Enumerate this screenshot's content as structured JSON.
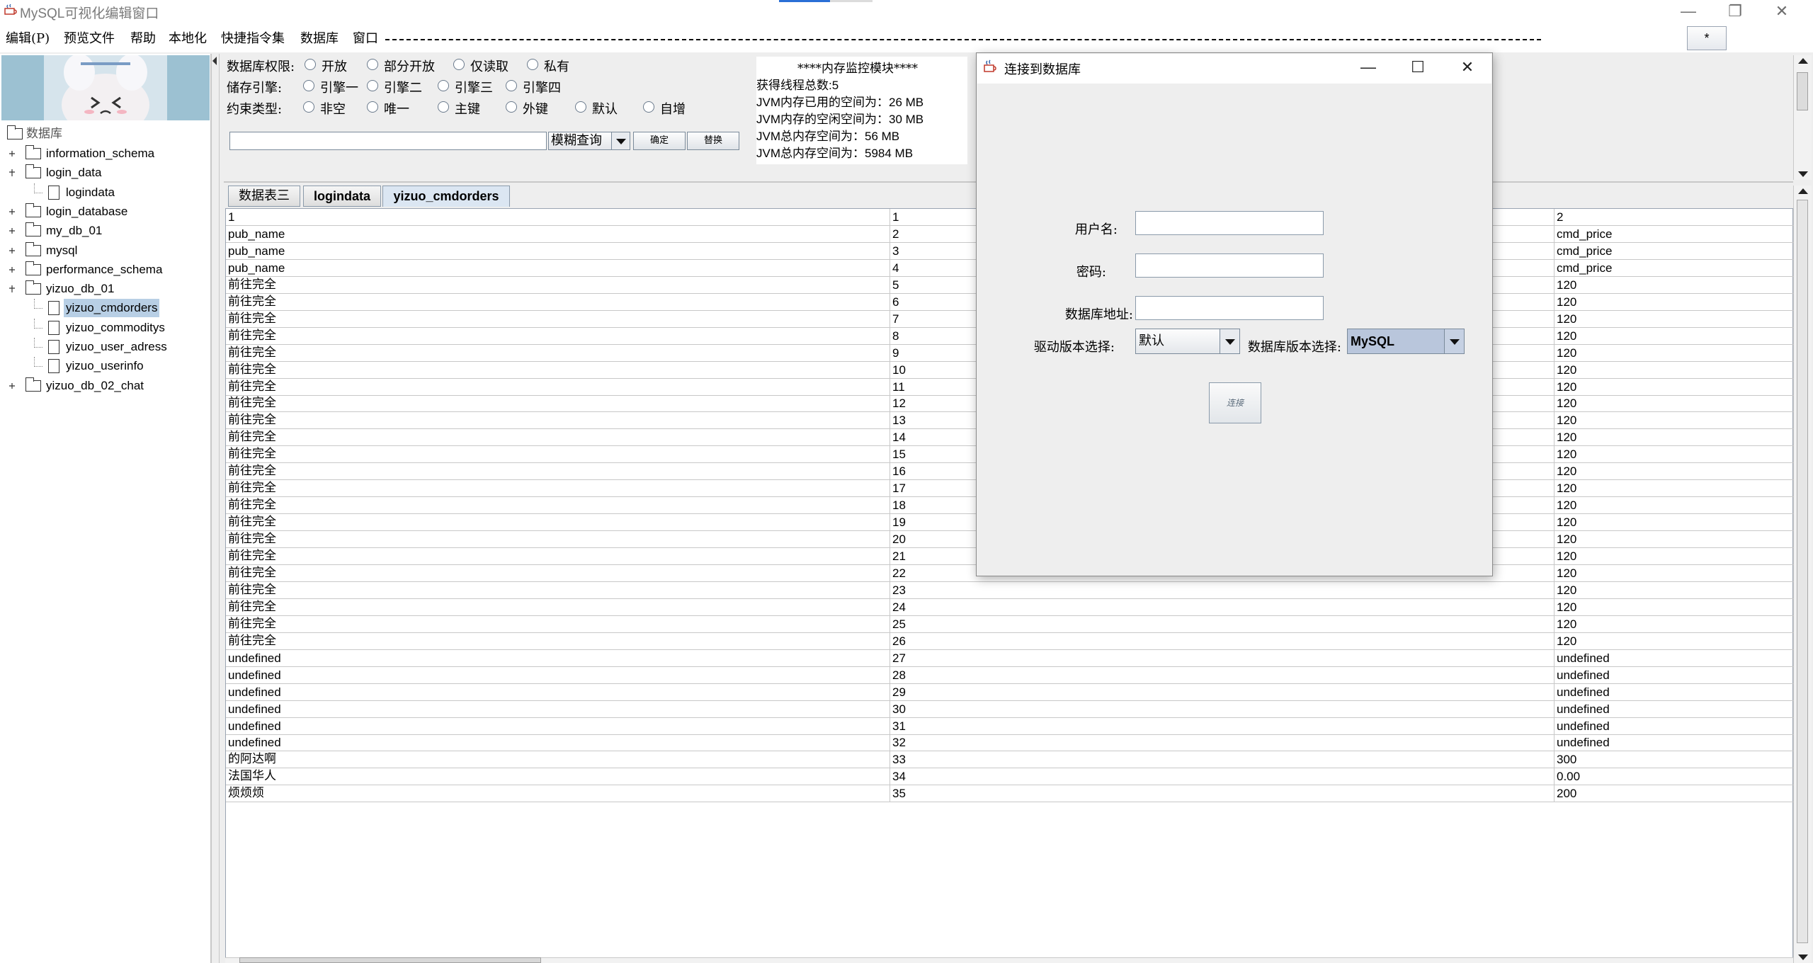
{
  "window": {
    "title": "MySQL可视化编辑窗口",
    "controls": {
      "minimize": "—",
      "restore": "❐",
      "close": "✕"
    }
  },
  "menu": {
    "items": [
      "编辑(P)",
      "预览文件",
      "帮助",
      "本地化",
      "快捷指令集",
      "数据库",
      "窗口"
    ],
    "star_button": "*"
  },
  "tree": {
    "root": "数据库",
    "nodes": [
      {
        "label": "information_schema",
        "type": "folder",
        "level": 1
      },
      {
        "label": "login_data",
        "type": "folder",
        "level": 1,
        "expanded": true
      },
      {
        "label": "logindata",
        "type": "file",
        "level": 2
      },
      {
        "label": "login_database",
        "type": "folder",
        "level": 1
      },
      {
        "label": "my_db_01",
        "type": "folder",
        "level": 1
      },
      {
        "label": "mysql",
        "type": "folder",
        "level": 1
      },
      {
        "label": "performance_schema",
        "type": "folder",
        "level": 1
      },
      {
        "label": "yizuo_db_01",
        "type": "folder",
        "level": 1,
        "expanded": true
      },
      {
        "label": "yizuo_cmdorders",
        "type": "file",
        "level": 2,
        "selected": true
      },
      {
        "label": "yizuo_commoditys",
        "type": "file",
        "level": 2
      },
      {
        "label": "yizuo_user_adress",
        "type": "file",
        "level": 2
      },
      {
        "label": "yizuo_userinfo",
        "type": "file",
        "level": 2
      },
      {
        "label": "yizuo_db_02_chat",
        "type": "folder",
        "level": 1
      }
    ]
  },
  "options": {
    "permission": {
      "label": "数据库权限:",
      "choices": [
        "开放",
        "部分开放",
        "仅读取",
        "私有"
      ]
    },
    "engine": {
      "label": "储存引擎:",
      "choices": [
        "引擎一",
        "引擎二",
        "引擎三",
        "引擎四"
      ]
    },
    "constraint": {
      "label": "约束类型:",
      "choices": [
        "非空",
        "唯一",
        "主键",
        "外键",
        "默认",
        "自增"
      ]
    },
    "search": {
      "value": "",
      "mode": "模糊查询",
      "confirm": "确定",
      "replace": "替换"
    }
  },
  "memory": {
    "header": "****内存监控模块****",
    "lines": [
      "获得线程总数:5",
      "JVM内存已用的空间为：26 MB",
      "JVM内存的空闲空间为：30 MB",
      "JVM总内存空间为：56 MB",
      "JVM总内存空间为：5984 MB"
    ]
  },
  "tabs": [
    "数据表三",
    "logindata",
    "yizuo_cmdorders"
  ],
  "active_tab": "yizuo_cmdorders",
  "table": {
    "rows": [
      [
        "1",
        "1",
        "2"
      ],
      [
        "pub_name",
        "2",
        "cmd_price"
      ],
      [
        "pub_name",
        "3",
        "cmd_price"
      ],
      [
        "pub_name",
        "4",
        "cmd_price"
      ],
      [
        "前往完全",
        "5",
        "120"
      ],
      [
        "前往完全",
        "6",
        "120"
      ],
      [
        "前往完全",
        "7",
        "120"
      ],
      [
        "前往完全",
        "8",
        "120"
      ],
      [
        "前往完全",
        "9",
        "120"
      ],
      [
        "前往完全",
        "10",
        "120"
      ],
      [
        "前往完全",
        "11",
        "120"
      ],
      [
        "前往完全",
        "12",
        "120"
      ],
      [
        "前往完全",
        "13",
        "120"
      ],
      [
        "前往完全",
        "14",
        "120"
      ],
      [
        "前往完全",
        "15",
        "120"
      ],
      [
        "前往完全",
        "16",
        "120"
      ],
      [
        "前往完全",
        "17",
        "120"
      ],
      [
        "前往完全",
        "18",
        "120"
      ],
      [
        "前往完全",
        "19",
        "120"
      ],
      [
        "前往完全",
        "20",
        "120"
      ],
      [
        "前往完全",
        "21",
        "120"
      ],
      [
        "前往完全",
        "22",
        "120"
      ],
      [
        "前往完全",
        "23",
        "120"
      ],
      [
        "前往完全",
        "24",
        "120"
      ],
      [
        "前往完全",
        "25",
        "120"
      ],
      [
        "前往完全",
        "26",
        "120"
      ],
      [
        "undefined",
        "27",
        "undefined"
      ],
      [
        "undefined",
        "28",
        "undefined"
      ],
      [
        "undefined",
        "29",
        "undefined"
      ],
      [
        "undefined",
        "30",
        "undefined"
      ],
      [
        "undefined",
        "31",
        "undefined"
      ],
      [
        "undefined",
        "32",
        "undefined"
      ],
      [
        "的阿达啊",
        "33",
        "300"
      ],
      [
        "法国华人",
        "34",
        "0.00"
      ],
      [
        "烦烦烦",
        "35",
        "200"
      ]
    ]
  },
  "dialog": {
    "title": "连接到数据库",
    "username_label": "用户名:",
    "username_value": "",
    "password_label": "密码:",
    "password_value": "",
    "address_label": "数据库地址:",
    "address_value": "",
    "driver_label": "驱动版本选择:",
    "driver_value": "默认",
    "db_version_label": "数据库版本选择:",
    "db_version_value": "MySQL",
    "connect_button": "连接",
    "controls": {
      "minimize": "—",
      "maximize": "☐",
      "close": "✕"
    }
  }
}
